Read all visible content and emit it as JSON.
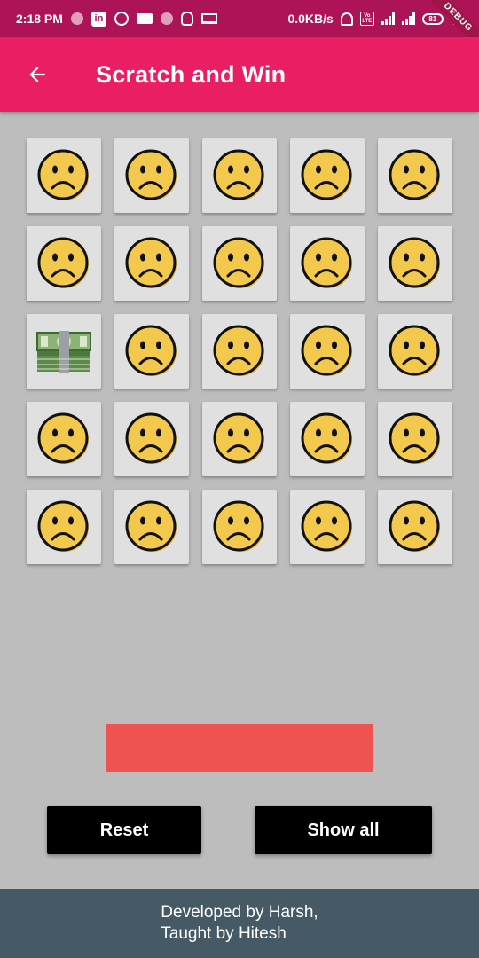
{
  "status_bar": {
    "time": "2:18 PM",
    "network_speed": "0.0KB/s",
    "battery": "81",
    "network_type": "4G",
    "debug_label": "DEBUG"
  },
  "app_bar": {
    "title": "Scratch and Win",
    "back_icon": "arrow-back-icon"
  },
  "grid": {
    "rows": 5,
    "columns": 5,
    "tiles": [
      "sad-face-icon",
      "sad-face-icon",
      "sad-face-icon",
      "sad-face-icon",
      "sad-face-icon",
      "sad-face-icon",
      "sad-face-icon",
      "sad-face-icon",
      "sad-face-icon",
      "sad-face-icon",
      "money-icon",
      "sad-face-icon",
      "sad-face-icon",
      "sad-face-icon",
      "sad-face-icon",
      "sad-face-icon",
      "sad-face-icon",
      "sad-face-icon",
      "sad-face-icon",
      "sad-face-icon",
      "sad-face-icon",
      "sad-face-icon",
      "sad-face-icon",
      "sad-face-icon",
      "sad-face-icon"
    ]
  },
  "actions": {
    "reset_label": "Reset",
    "show_all_label": "Show all"
  },
  "footer": {
    "line1": "Developed by Harsh,",
    "line2": "Taught by Hitesh"
  },
  "colors": {
    "status_bar": "#ad1457",
    "app_bar": "#e91e63",
    "background": "#bdbdbd",
    "tile": "#e0e0e0",
    "result_bar": "#ef5350",
    "button": "#000000",
    "footer": "#455a64"
  }
}
